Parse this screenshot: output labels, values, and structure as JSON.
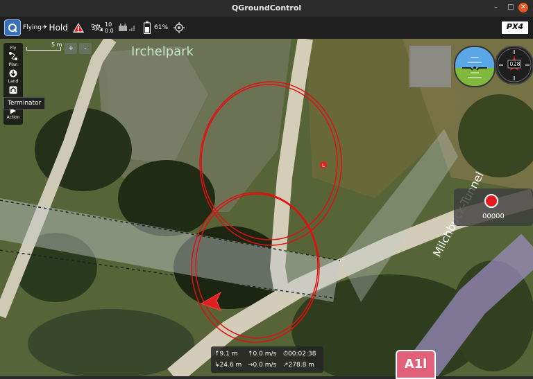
{
  "window": {
    "title": "QGroundControl",
    "minimize": "–",
    "maximize": "□",
    "close": "✕"
  },
  "toolbar": {
    "flight_state": "Flying",
    "flight_mode": "Hold",
    "gps_sats": "10",
    "gps_hdop": "0.0",
    "battery_pct": "61%",
    "brand": "PX4"
  },
  "sidebar": {
    "items": [
      {
        "label": "Fly",
        "icon": "plane-icon"
      },
      {
        "label": "Plan",
        "icon": "route-icon"
      },
      {
        "label": "Land",
        "icon": "land-arrow-icon"
      },
      {
        "label": "Action",
        "icon": "play-icon"
      }
    ],
    "tooltip": "Terminator"
  },
  "map": {
    "scale_label": "5 m",
    "zoom_in": "+",
    "zoom_out": "-",
    "park_label": "Irchelpark",
    "street_label": "Milchbuck-Tunnel",
    "road_sign": "A1l",
    "home_marker": "L"
  },
  "instruments": {
    "heading": "028"
  },
  "recording": {
    "time": "00000"
  },
  "telemetry": {
    "altitude": "9.1 m",
    "vertical_speed": "0.0 m/s",
    "flight_time": "00:02:38",
    "distance": "24.6 m",
    "ground_speed": "0.0 m/s",
    "heading": "278.8 m"
  },
  "colors": {
    "track": "#e01010",
    "accent": "#e21c1c",
    "toolbar_bg": "#1f1f1f"
  }
}
